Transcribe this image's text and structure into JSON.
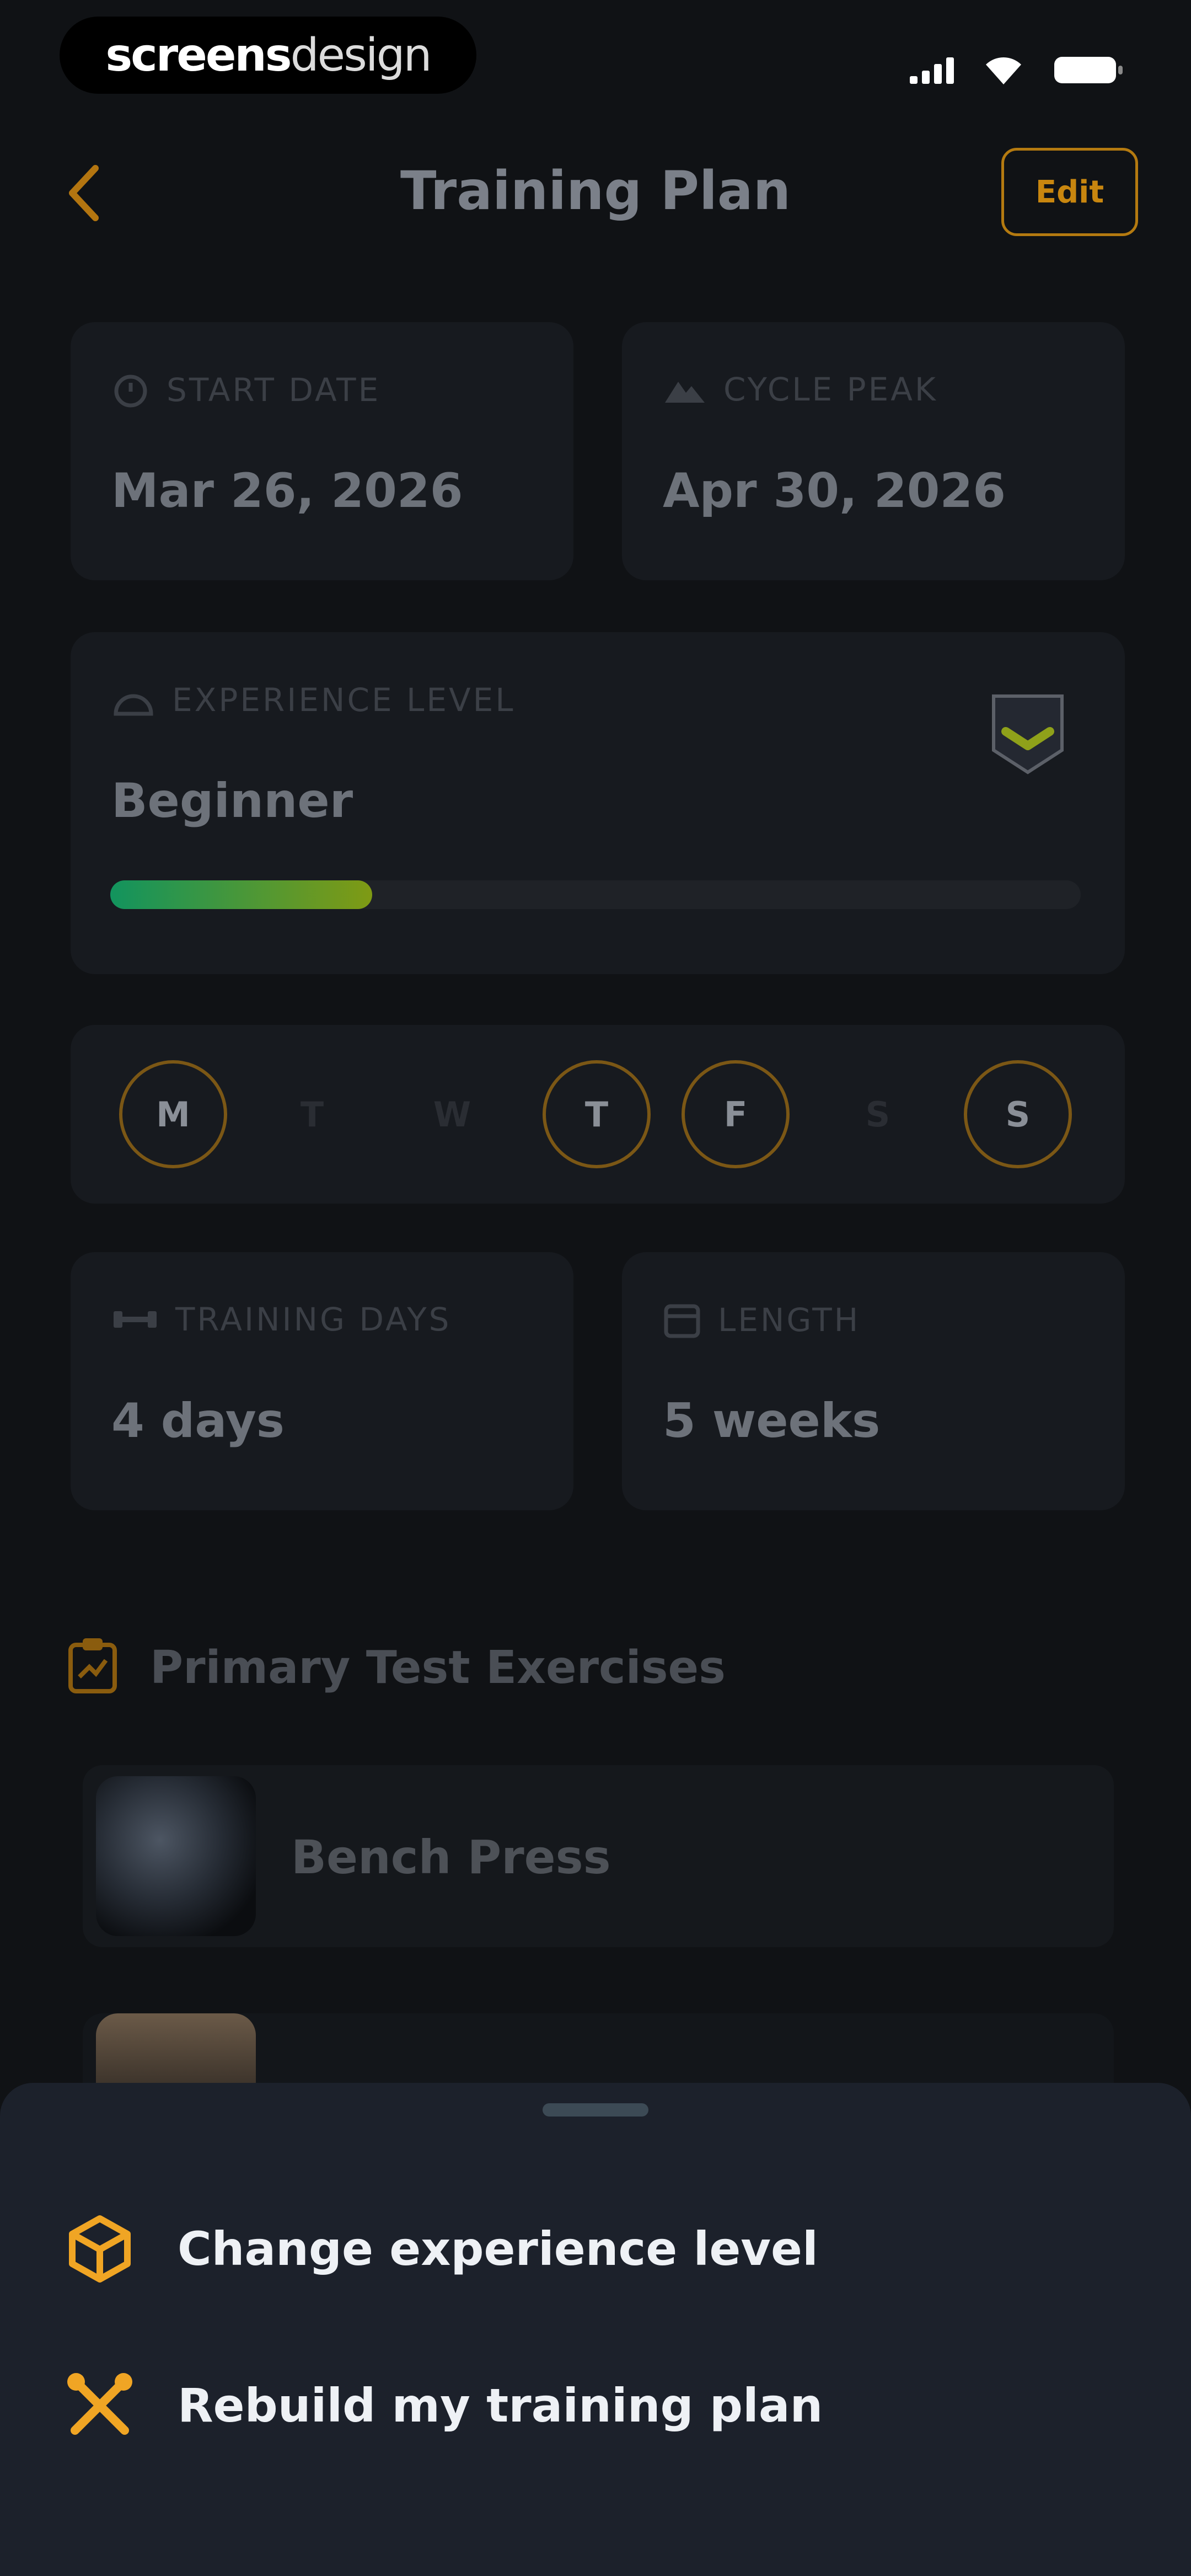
{
  "status_bar": {
    "brand_bold": "screens",
    "brand_light": "design"
  },
  "header": {
    "title": "Training Plan",
    "edit_label": "Edit"
  },
  "cards": {
    "start_date": {
      "label": "START DATE",
      "value": "Mar 26, 2026"
    },
    "cycle_peak": {
      "label": "CYCLE PEAK",
      "value": "Apr 30, 2026"
    },
    "experience": {
      "label": "EXPERIENCE LEVEL",
      "value": "Beginner",
      "progress": 0.27
    },
    "training_days": {
      "label": "TRAINING DAYS",
      "value": "4 days"
    },
    "length": {
      "label": "LENGTH",
      "value": "5 weeks"
    }
  },
  "weekdays": [
    {
      "letter": "M",
      "selected": true
    },
    {
      "letter": "T",
      "selected": false
    },
    {
      "letter": "W",
      "selected": false
    },
    {
      "letter": "T",
      "selected": true
    },
    {
      "letter": "F",
      "selected": true
    },
    {
      "letter": "S",
      "selected": false
    },
    {
      "letter": "S",
      "selected": true
    }
  ],
  "exercises_section": {
    "title": "Primary Test Exercises",
    "items": [
      {
        "name": "Bench Press"
      }
    ]
  },
  "sheet": {
    "items": [
      {
        "label": "Change experience level",
        "icon": "cube-icon"
      },
      {
        "label": "Rebuild my training plan",
        "icon": "tools-icon"
      }
    ]
  },
  "colors": {
    "background": "#101215",
    "card": "#171a1f",
    "accent": "#f0a524",
    "sheet": "#1c212b",
    "progress_start": "#12945e",
    "progress_end": "#7f9a14"
  }
}
